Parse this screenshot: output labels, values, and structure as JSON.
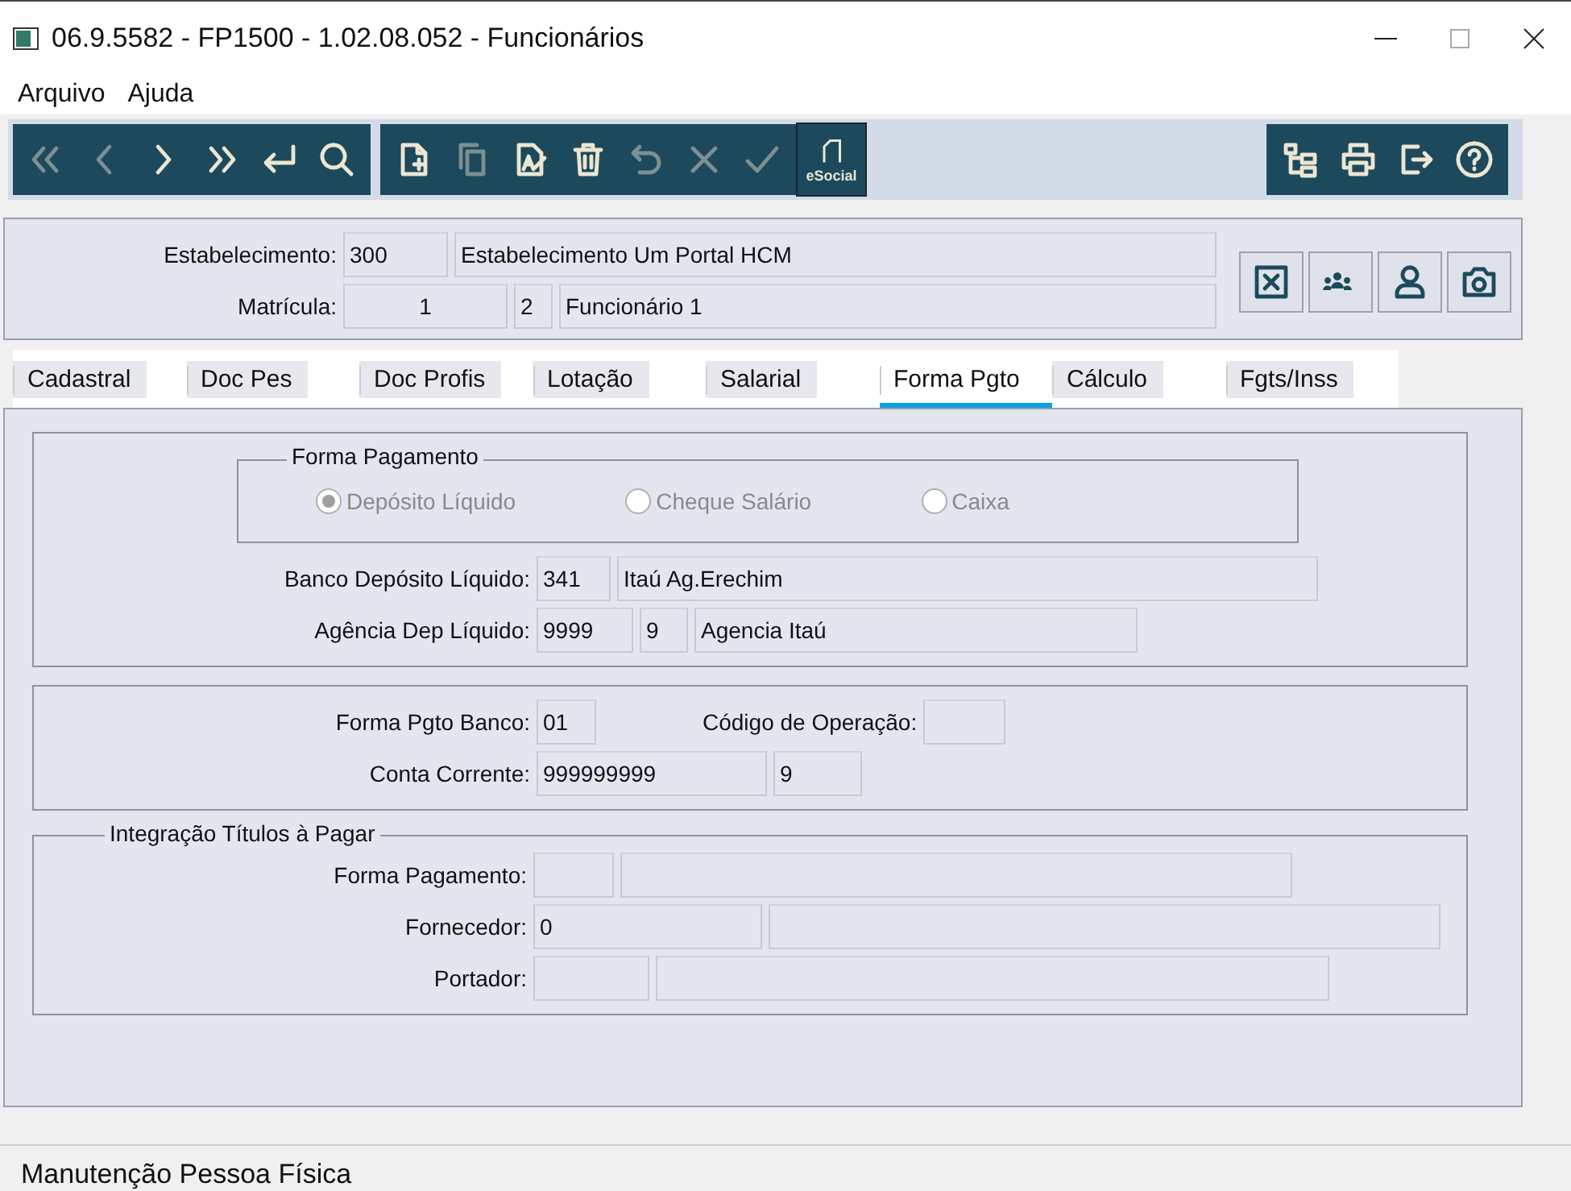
{
  "window": {
    "title": "06.9.5582 - FP1500 - 1.02.08.052 - Funcionários"
  },
  "menu": [
    {
      "label": "Arquivo"
    },
    {
      "label": "Ajuda"
    }
  ],
  "toolbar": {
    "groups": [
      {
        "items": [
          {
            "kind": "first",
            "disabled": true
          },
          {
            "kind": "prev",
            "disabled": true
          },
          {
            "kind": "next",
            "disabled": false
          },
          {
            "kind": "last",
            "disabled": false
          },
          {
            "kind": "enter",
            "disabled": false
          },
          {
            "kind": "search",
            "disabled": false
          }
        ]
      },
      {
        "items": [
          {
            "kind": "new",
            "disabled": false
          },
          {
            "kind": "copy",
            "disabled": true
          },
          {
            "kind": "edit",
            "disabled": false
          },
          {
            "kind": "delete",
            "disabled": false
          },
          {
            "kind": "undo",
            "disabled": true
          },
          {
            "kind": "cancel",
            "disabled": true
          },
          {
            "kind": "confirm",
            "disabled": true
          }
        ]
      },
      {
        "items": [
          {
            "kind": "esocial",
            "label": "eSocial",
            "disabled": false
          }
        ]
      },
      {
        "items": [
          {
            "kind": "tree",
            "disabled": false
          },
          {
            "kind": "print",
            "disabled": false
          },
          {
            "kind": "exit",
            "disabled": false
          },
          {
            "kind": "help",
            "disabled": false
          }
        ]
      }
    ]
  },
  "header": {
    "rows": [
      {
        "label": "Estabelecimento:",
        "fields": [
          {
            "value": "300"
          },
          {
            "value": "Estabelecimento Um Portal HCM"
          }
        ]
      },
      {
        "label": "Matrícula:",
        "fields": [
          {
            "value": "1"
          },
          {
            "value": "2"
          },
          {
            "value": "Funcionário 1"
          }
        ]
      }
    ],
    "buttons": [
      {
        "kind": "close-box"
      },
      {
        "kind": "people"
      },
      {
        "kind": "person"
      },
      {
        "kind": "camera"
      }
    ]
  },
  "tabs": [
    {
      "label": "Cadastral",
      "selected": false
    },
    {
      "label": "Doc Pes",
      "selected": false
    },
    {
      "label": "Doc Profis",
      "selected": false
    },
    {
      "label": "Lotação",
      "selected": false
    },
    {
      "label": "Salarial",
      "selected": false
    },
    {
      "label": "Forma Pgto",
      "selected": true
    },
    {
      "label": "Cálculo",
      "selected": false
    },
    {
      "label": "Fgts/Inss",
      "selected": false
    }
  ],
  "groups": [
    {
      "radio_group": {
        "title": "Forma Pagamento",
        "options": [
          {
            "label": "Depósito Líquido",
            "selected": true,
            "disabled": true
          },
          {
            "label": "Cheque Salário",
            "selected": false,
            "disabled": true
          },
          {
            "label": "Caixa",
            "selected": false,
            "disabled": true
          }
        ]
      },
      "rows": [
        {
          "label": "Banco Depósito Líquido:",
          "fields": [
            {
              "value": "341"
            },
            {
              "value": "Itaú Ag.Erechim"
            }
          ]
        },
        {
          "label": "Agência Dep Líquido:",
          "fields": [
            {
              "value": "9999"
            },
            {
              "value": "9"
            },
            {
              "value": "Agencia Itaú"
            }
          ]
        }
      ]
    },
    {
      "rows": [
        {
          "label": "Forma Pgto Banco:",
          "fields": [
            {
              "value": "01"
            }
          ],
          "after": {
            "label": "Código de Operação:"
          }
        },
        {
          "label": "Conta Corrente:",
          "fields": [
            {
              "value": "999999999"
            },
            {
              "value": "9"
            }
          ]
        }
      ]
    },
    {
      "title": "Integração Títulos à Pagar",
      "rows": [
        {
          "label": "Forma Pagamento:"
        },
        {
          "label": "Fornecedor:",
          "fields": [
            {
              "value": "0"
            }
          ]
        },
        {
          "label": "Portador:"
        }
      ]
    }
  ],
  "status_bar": {
    "text": "Manutenção Pessoa Física"
  }
}
